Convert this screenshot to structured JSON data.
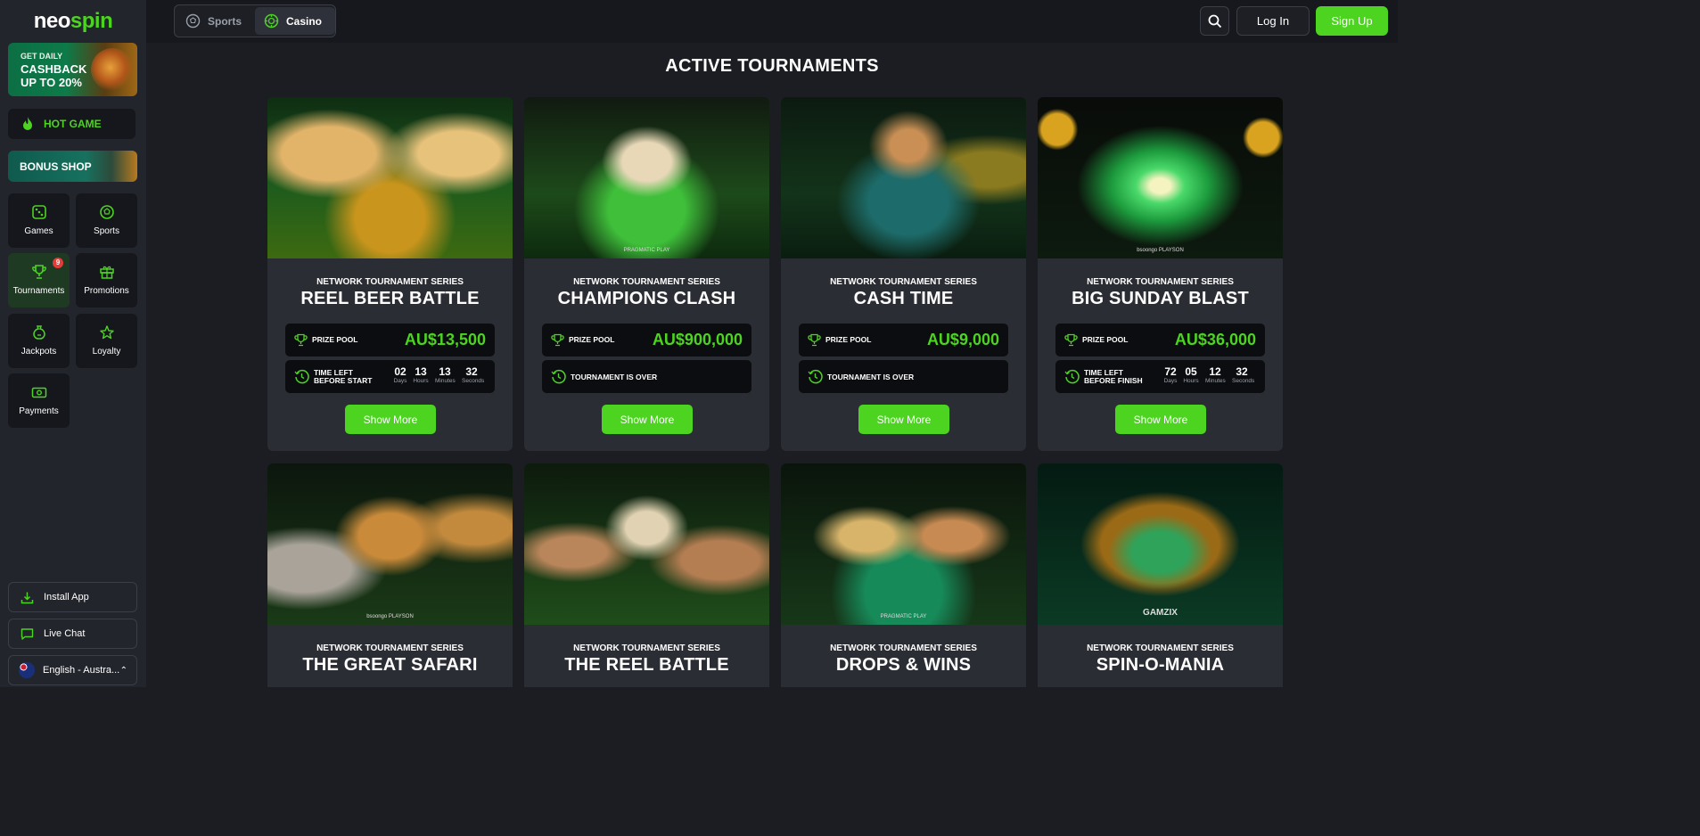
{
  "brand": {
    "logo_left": "neo",
    "logo_right": "spin"
  },
  "sidebar": {
    "cashback": {
      "line1": "GET DAILY",
      "line2": "CASHBACK",
      "line3": "UP TO 20%"
    },
    "hot_game": "HOT GAME",
    "bonus_shop": "BONUS SHOP",
    "nav": [
      {
        "label": "Games",
        "icon": "dice-icon"
      },
      {
        "label": "Sports",
        "icon": "ball-icon"
      },
      {
        "label": "Tournaments",
        "icon": "trophy-icon",
        "badge": "9",
        "active": true
      },
      {
        "label": "Promotions",
        "icon": "gift-icon"
      },
      {
        "label": "Jackpots",
        "icon": "moneybag-icon"
      },
      {
        "label": "Loyalty",
        "icon": "star-icon"
      },
      {
        "label": "Payments",
        "icon": "cash-icon"
      }
    ],
    "install_app": "Install App",
    "live_chat": "Live Chat",
    "language": "English - Austra..."
  },
  "topbar": {
    "tabs": [
      "Sports",
      "Casino"
    ],
    "active_tab": "Casino",
    "login": "Log In",
    "signup": "Sign Up"
  },
  "main": {
    "title": "ACTIVE TOURNAMENTS",
    "labels": {
      "series": "NETWORK TOURNAMENT SERIES",
      "prize_pool": "PRIZE POOL",
      "time_left_before_start": [
        "TIME LEFT",
        "BEFORE START"
      ],
      "time_left_before_finish": [
        "TIME LEFT",
        "BEFORE FINISH"
      ],
      "over": "TOURNAMENT IS OVER",
      "show_more": "Show More",
      "units": [
        "Days",
        "Hours",
        "Minutes",
        "Seconds"
      ]
    },
    "tournaments": [
      {
        "name": "REEL BEER BATTLE",
        "prize": "AU$13,500",
        "status": "start",
        "countdown": [
          "02",
          "13",
          "13",
          "32"
        ]
      },
      {
        "name": "CHAMPIONS CLASH",
        "prize": "AU$900,000",
        "status": "over",
        "provider": "PRAGMATIC PLAY"
      },
      {
        "name": "CASH TIME",
        "prize": "AU$9,000",
        "status": "over"
      },
      {
        "name": "BIG SUNDAY BLAST",
        "prize": "AU$36,000",
        "status": "finish",
        "countdown": [
          "72",
          "05",
          "12",
          "32"
        ],
        "provider": "bsoongo  PLAYSON"
      },
      {
        "name": "THE GREAT SAFARI",
        "provider": "bsoongo  PLAYSON"
      },
      {
        "name": "THE REEL BATTLE"
      },
      {
        "name": "DROPS & WINS",
        "provider": "PRAGMATIC PLAY"
      },
      {
        "name": "SPIN-O-MANIA",
        "provider": "GAMZIX"
      }
    ]
  },
  "colors": {
    "accent": "#4cd421",
    "bg": "#1b1d23",
    "sidebar": "#23252c",
    "card": "#2b2d34",
    "box": "#0c0d10"
  }
}
